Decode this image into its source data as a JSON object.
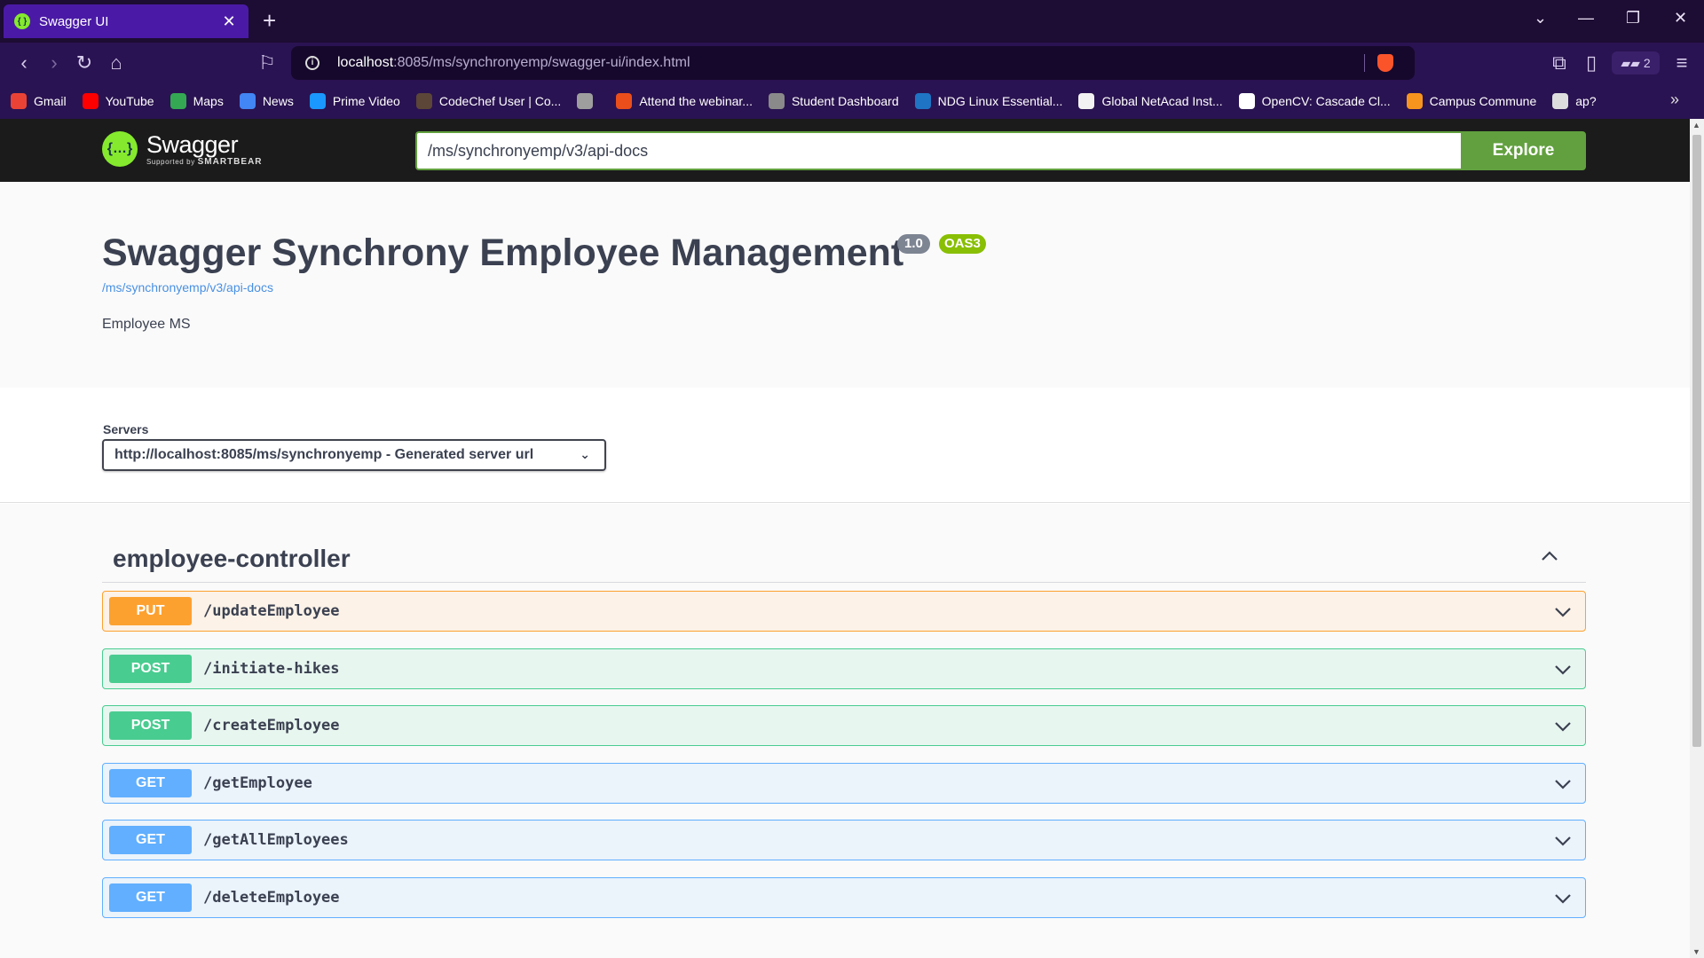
{
  "browser": {
    "tab_title": "Swagger UI",
    "new_tab": "+",
    "url_host": "localhost",
    "url_path": ":8085/ms/synchronyemp/swagger-ui/index.html",
    "wallet_count": "2",
    "bookmarks": [
      {
        "label": "Gmail",
        "color": "#ea4335"
      },
      {
        "label": "YouTube",
        "color": "#ff0000"
      },
      {
        "label": "Maps",
        "color": "#34a853"
      },
      {
        "label": "News",
        "color": "#4285f4"
      },
      {
        "label": "Prime Video",
        "color": "#1a98ff"
      },
      {
        "label": "CodeChef User | Co...",
        "color": "#5b4638"
      },
      {
        "label": "",
        "color": "#9e9e9e"
      },
      {
        "label": "Attend the webinar...",
        "color": "#e94e1b"
      },
      {
        "label": "Student Dashboard",
        "color": "#8a8a8a"
      },
      {
        "label": "NDG Linux Essential...",
        "color": "#1f74c4"
      },
      {
        "label": "Global NetAcad Inst...",
        "color": "#f2f2f2"
      },
      {
        "label": "OpenCV: Cascade Cl...",
        "color": "#ffffff"
      },
      {
        "label": "Campus Commune",
        "color": "#f7941d"
      },
      {
        "label": "ap?",
        "color": "#dddddd"
      }
    ]
  },
  "swagger": {
    "brand": "Swagger",
    "brand_sub": "Supported by",
    "brand_sub_strong": "SMARTBEAR",
    "explore_value": "/ms/synchronyemp/v3/api-docs",
    "explore_label": "Explore",
    "title": "Swagger Synchrony Employee Management",
    "version": "1.0",
    "oas": "OAS3",
    "spec_link": "/ms/synchronyemp/v3/api-docs",
    "description": "Employee MS",
    "servers_label": "Servers",
    "server_selected": "http://localhost:8085/ms/synchronyemp - Generated server url",
    "tag": "employee-controller",
    "operations": [
      {
        "method": "PUT",
        "path": "/updateEmployee"
      },
      {
        "method": "POST",
        "path": "/initiate-hikes"
      },
      {
        "method": "POST",
        "path": "/createEmployee"
      },
      {
        "method": "GET",
        "path": "/getEmployee"
      },
      {
        "method": "GET",
        "path": "/getAllEmployees"
      },
      {
        "method": "GET",
        "path": "/deleteEmployee"
      }
    ]
  },
  "colors": {
    "put": "#fca130",
    "post": "#49cc90",
    "get": "#61affe",
    "explore": "#62a03f",
    "brand_green": "#85ea2d"
  }
}
